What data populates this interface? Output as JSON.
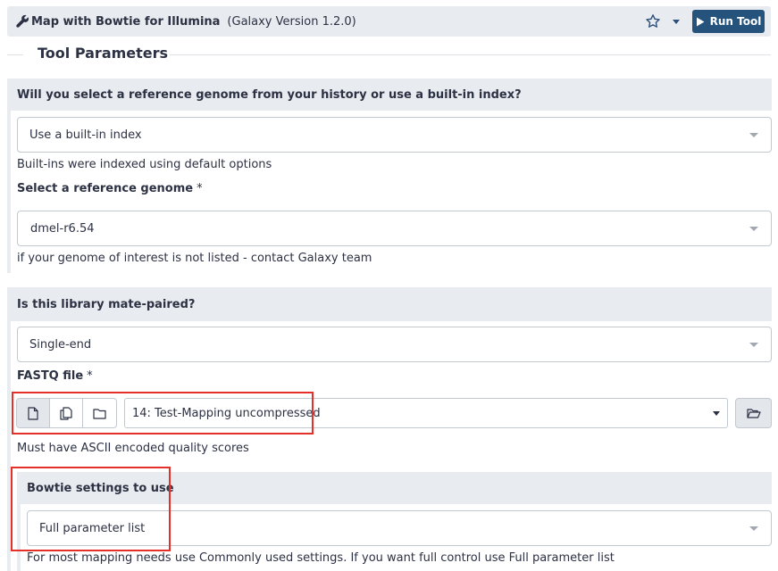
{
  "header": {
    "tool_name": "Map with Bowtie for Illumina",
    "version": "(Galaxy Version 1.2.0)",
    "run_label": "Run Tool"
  },
  "section_title": "Tool Parameters",
  "reference": {
    "question": "Will you select a reference genome from your history or use a built-in index?",
    "source_value": "Use a built-in index",
    "source_help": "Built-ins were indexed using default options",
    "genome_label": "Select a reference genome",
    "required_mark": "*",
    "genome_value": "dmel-r6.54",
    "genome_help": "if your genome of interest is not listed - contact Galaxy team"
  },
  "library": {
    "question": "Is this library mate-paired?",
    "value": "Single-end",
    "fastq_label": "FASTQ file",
    "required_mark": "*",
    "fastq_value": "14: Test-Mapping uncompressed",
    "fastq_help": "Must have ASCII encoded quality scores"
  },
  "bowtie": {
    "question": "Bowtie settings to use",
    "value": "Full parameter list",
    "help": "For most mapping needs use Commonly used settings. If you want full control use Full parameter list"
  },
  "colors": {
    "run_button": "#25537b",
    "header_bg": "#e8ebef",
    "highlight": "#e5302a"
  }
}
